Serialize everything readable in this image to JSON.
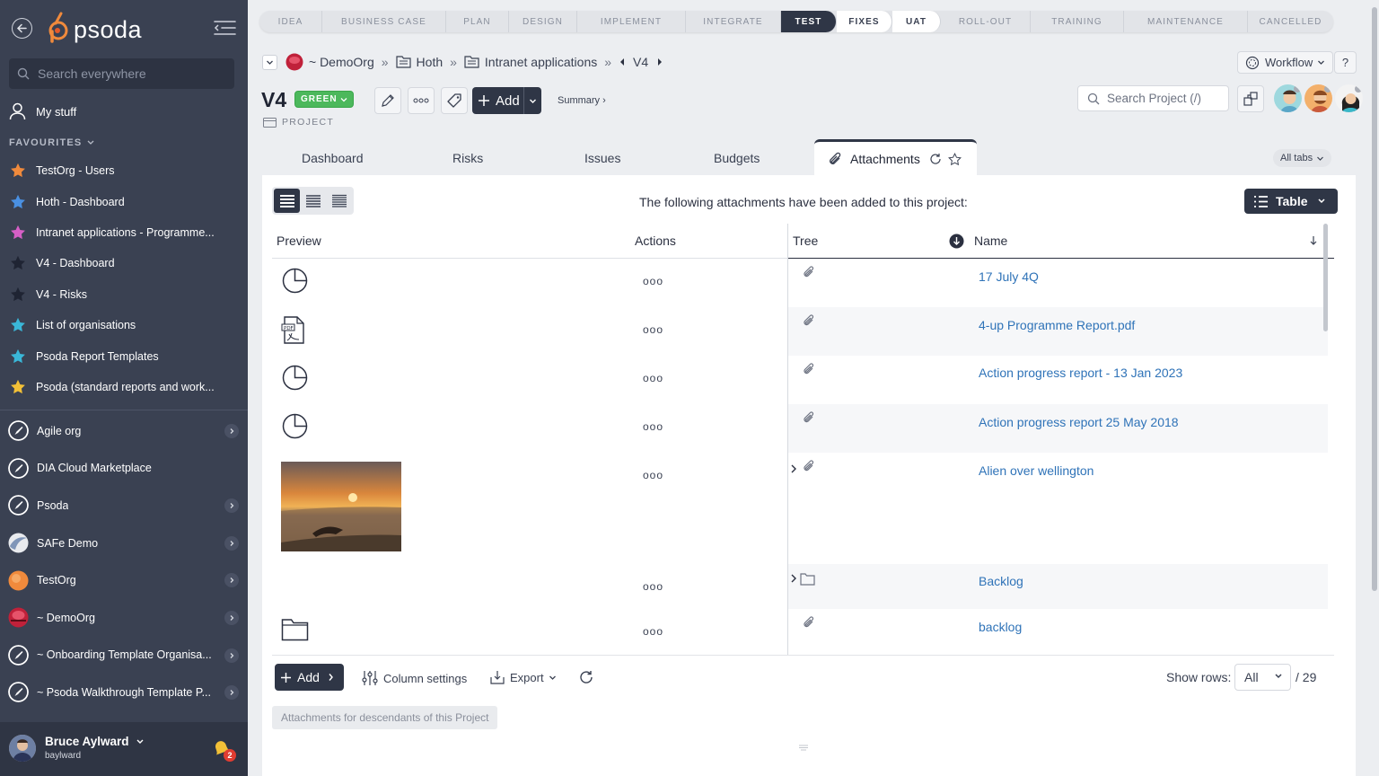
{
  "sidebar": {
    "logo": "psoda",
    "search_placeholder": "Search everywhere",
    "my_stuff": "My stuff",
    "favourites_heading": "FAVOURITES",
    "favourites": [
      {
        "label": "TestOrg - Users",
        "color": "#f08a3c"
      },
      {
        "label": "Hoth - Dashboard",
        "color": "#4a90e2"
      },
      {
        "label": "Intranet applications - Programme...",
        "color": "#d65fc6"
      },
      {
        "label": "V4 - Dashboard",
        "color": "#2b3040"
      },
      {
        "label": "V4 - Risks",
        "color": "#2b3040"
      },
      {
        "label": "List of organisations",
        "color": "#3ab7d8"
      },
      {
        "label": "Psoda Report Templates",
        "color": "#3ab7d8"
      },
      {
        "label": "Psoda (standard reports and work...",
        "color": "#f2c037"
      }
    ],
    "orgs": [
      {
        "label": "Agile org",
        "chevron": true
      },
      {
        "label": "DIA Cloud Marketplace",
        "chevron": false
      },
      {
        "label": "Psoda",
        "chevron": true
      },
      {
        "label": "SAFe Demo",
        "chevron": true
      },
      {
        "label": "TestOrg",
        "chevron": true
      },
      {
        "label": "~ DemoOrg",
        "chevron": true
      },
      {
        "label": "~ Onboarding Template Organisa...",
        "chevron": true
      },
      {
        "label": "~ Psoda Walkthrough Template P...",
        "chevron": true
      }
    ],
    "user": {
      "name": "Bruce Aylward",
      "login": "baylward",
      "notifications": "2"
    }
  },
  "stages": [
    {
      "label": "IDEA",
      "state": "todo"
    },
    {
      "label": "BUSINESS CASE",
      "state": "todo"
    },
    {
      "label": "PLAN",
      "state": "todo"
    },
    {
      "label": "DESIGN",
      "state": "todo"
    },
    {
      "label": "IMPLEMENT",
      "state": "todo"
    },
    {
      "label": "INTEGRATE",
      "state": "todo"
    },
    {
      "label": "TEST",
      "state": "active"
    },
    {
      "label": "FIXES",
      "state": "done"
    },
    {
      "label": "UAT",
      "state": "done"
    },
    {
      "label": "ROLL-OUT",
      "state": "todo"
    },
    {
      "label": "TRAINING",
      "state": "todo"
    },
    {
      "label": "MAINTENANCE",
      "state": "todo"
    },
    {
      "label": "CANCELLED",
      "state": "todo"
    }
  ],
  "breadcrumb": {
    "org": "~ DemoOrg",
    "programme": "Hoth",
    "project_group": "Intranet applications",
    "current": "V4"
  },
  "header": {
    "workflow": "Workflow",
    "help": "?",
    "title": "V4",
    "status": "GREEN",
    "type": "PROJECT",
    "add": "Add",
    "summary": "Summary ›",
    "search_placeholder": "Search Project (/)"
  },
  "tabs": {
    "items": [
      "Dashboard",
      "Risks",
      "Issues",
      "Budgets"
    ],
    "active": "Attachments",
    "all_tabs": "All tabs"
  },
  "panel": {
    "intro": "The following attachments have been added to this project:",
    "view_button": "Table",
    "columns": {
      "preview": "Preview",
      "actions": "Actions",
      "tree": "Tree",
      "name": "Name"
    },
    "rows": [
      {
        "name": "17 July 4Q",
        "preview": "chart",
        "tree": "attachment",
        "expand": false,
        "actions": "ooo"
      },
      {
        "name": "4-up Programme Report.pdf",
        "preview": "pdf",
        "tree": "attachment",
        "expand": false,
        "actions": "ooo"
      },
      {
        "name": "Action progress report - 13 Jan 2023",
        "preview": "chart",
        "tree": "attachment",
        "expand": false,
        "actions": "ooo"
      },
      {
        "name": "Action progress report 25 May 2018",
        "preview": "chart",
        "tree": "attachment",
        "expand": false,
        "actions": "ooo"
      },
      {
        "name": "Alien over wellington",
        "preview": "photo",
        "tree": "attachment",
        "expand": true,
        "actions": "ooo"
      },
      {
        "name": "Backlog",
        "preview": "none",
        "tree": "folder",
        "expand": true,
        "actions": "ooo"
      },
      {
        "name": "backlog",
        "preview": "folder",
        "tree": "attachment",
        "expand": false,
        "actions": "ooo"
      }
    ],
    "footer": {
      "add": "Add",
      "column_settings": "Column settings",
      "export": "Export",
      "show_rows_label": "Show rows:",
      "show_rows_value": "All",
      "total": "/ 29",
      "descendants": "Attachments for descendants of this Project"
    }
  }
}
